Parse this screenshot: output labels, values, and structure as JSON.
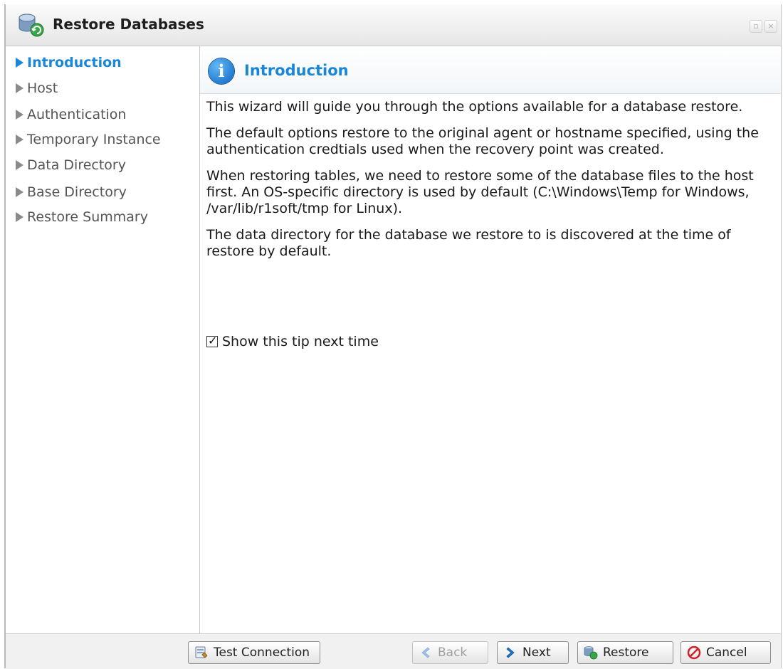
{
  "window": {
    "title": "Restore Databases"
  },
  "nav": {
    "items": [
      {
        "label": "Introduction",
        "active": true
      },
      {
        "label": "Host",
        "active": false
      },
      {
        "label": "Authentication",
        "active": false
      },
      {
        "label": "Temporary Instance",
        "active": false
      },
      {
        "label": "Data Directory",
        "active": false
      },
      {
        "label": "Base Directory",
        "active": false
      },
      {
        "label": "Restore Summary",
        "active": false
      }
    ]
  },
  "content": {
    "header_title": "Introduction",
    "paragraphs": [
      "This wizard will guide you through the options available for a database restore.",
      "The default options restore to the original agent or hostname specified, using the authentication credtials used when the recovery point was created.",
      "When restoring tables, we need to restore some of the database files to the host first. An OS-specific directory is used by default (C:\\Windows\\Temp for Windows, /var/lib/r1soft/tmp for Linux).",
      "The data directory for the database we restore to is discovered at the time of restore by default."
    ],
    "tip_label": "Show this tip next time",
    "tip_checked": true
  },
  "footer": {
    "test_connection": "Test Connection",
    "back": "Back",
    "next": "Next",
    "restore": "Restore",
    "cancel": "Cancel"
  },
  "colors": {
    "accent": "#1a86d8",
    "nav_text": "#555555",
    "cancel_icon": "#d0202a"
  },
  "icons": {
    "title": "database-restore-icon",
    "header": "info-icon",
    "test_connection": "connection-test-icon",
    "back": "arrow-left-icon",
    "next": "arrow-right-icon",
    "restore": "database-restore-icon",
    "cancel": "cancel-circle-icon"
  }
}
